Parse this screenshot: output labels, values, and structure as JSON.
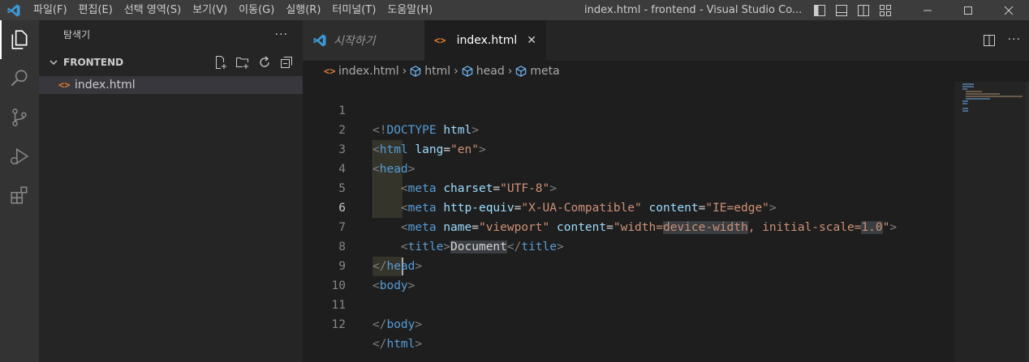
{
  "titlebar": {
    "menu": [
      "파일(F)",
      "편집(E)",
      "선택 영역(S)",
      "보기(V)",
      "이동(G)",
      "실행(R)",
      "터미널(T)",
      "도움말(H)"
    ],
    "window_title": "index.html - frontend - Visual Studio Co..."
  },
  "sidebar": {
    "title": "탐색기",
    "more": "···",
    "section_title": "FRONTEND",
    "files": [
      {
        "name": "index.html",
        "icon": "html-file-icon"
      }
    ]
  },
  "tabs": [
    {
      "label": "시작하기",
      "icon": "vscode-icon",
      "active": false
    },
    {
      "label": "index.html",
      "icon": "html-file-icon",
      "active": true,
      "close": "✕"
    }
  ],
  "tab_more": "···",
  "breadcrumb": [
    "index.html",
    "html",
    "head",
    "meta"
  ],
  "breadcrumb_sep": "›",
  "editor": {
    "line_numbers": [
      "1",
      "2",
      "3",
      "4",
      "5",
      "6",
      "7",
      "8",
      "9",
      "10",
      "11",
      "12"
    ],
    "current_line": 6
  },
  "colors": {
    "tag": "#569cd6",
    "attr": "#9cdcfe",
    "string": "#ce9178",
    "punctuation": "#808080",
    "html_icon": "#e37933",
    "vscode_blue": "#3c99d4"
  }
}
